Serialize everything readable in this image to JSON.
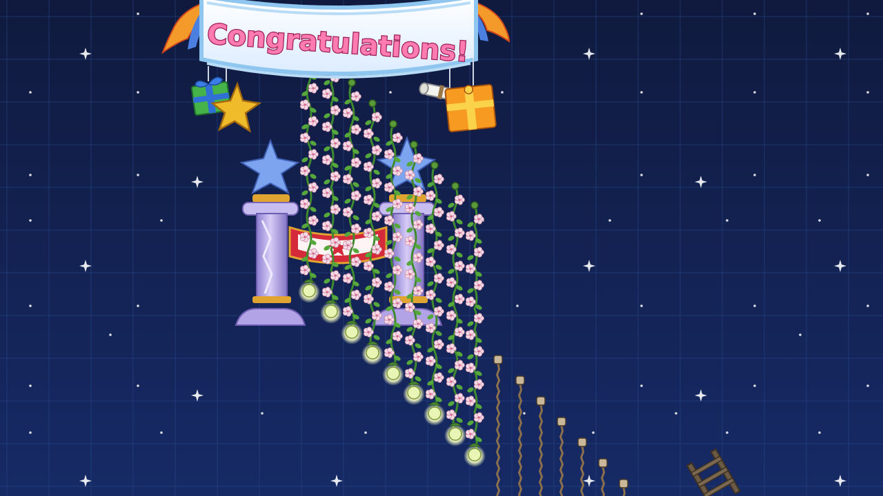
{
  "scene": {
    "banner_text": "Congratulations!",
    "colors": {
      "sky_top": "#101a3e",
      "sky_bottom": "#162a66",
      "grid": "#2a4a8e",
      "banner_fill": "#eef6ff",
      "banner_border": "#8fc6f0",
      "banner_text_fill": "#ff7bb0",
      "banner_text_stroke": "#9b1d58",
      "vine": "#3f8a2f",
      "blossom": "#f7dbe6",
      "lantern": "#e9f5b4",
      "pillar": "#b7a8e8",
      "pillar_star": "#7da4ee",
      "gold": "#e0a431",
      "gift_green": "#45b24a",
      "gift_orange": "#f69a22",
      "star_gold": "#f0bb2a",
      "rope": "#8c6f4b"
    },
    "icons": {
      "stars": "sparkle-icon",
      "left_gift": "green-gift-box-icon",
      "right_gift": "orange-gift-box-icon",
      "scroll": "rolled-scroll-icon",
      "hanging_star": "gold-star-icon",
      "lantern": "vine-lantern-icon",
      "ladder": "ladder-icon"
    }
  }
}
